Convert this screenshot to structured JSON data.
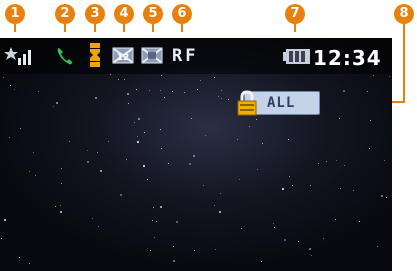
{
  "callouts": [
    "1",
    "2",
    "3",
    "4",
    "5",
    "6",
    "7",
    "8"
  ],
  "status_bar": {
    "icons": [
      "signal-strength-icon",
      "call-icon",
      "vibrate-icon",
      "keypad-lock-icon",
      "silent-mode-icon",
      "rf-indicator-icon",
      "battery-icon"
    ],
    "rf_text": "RF",
    "clock": "12:34"
  },
  "lock_indicator": {
    "icon": "padlock-icon",
    "label": "ALL"
  },
  "colors": {
    "callout": "#e8800e",
    "wallpaper": "#12141f",
    "lock_box": "#c4d3e8",
    "clock": "#ffffff"
  }
}
